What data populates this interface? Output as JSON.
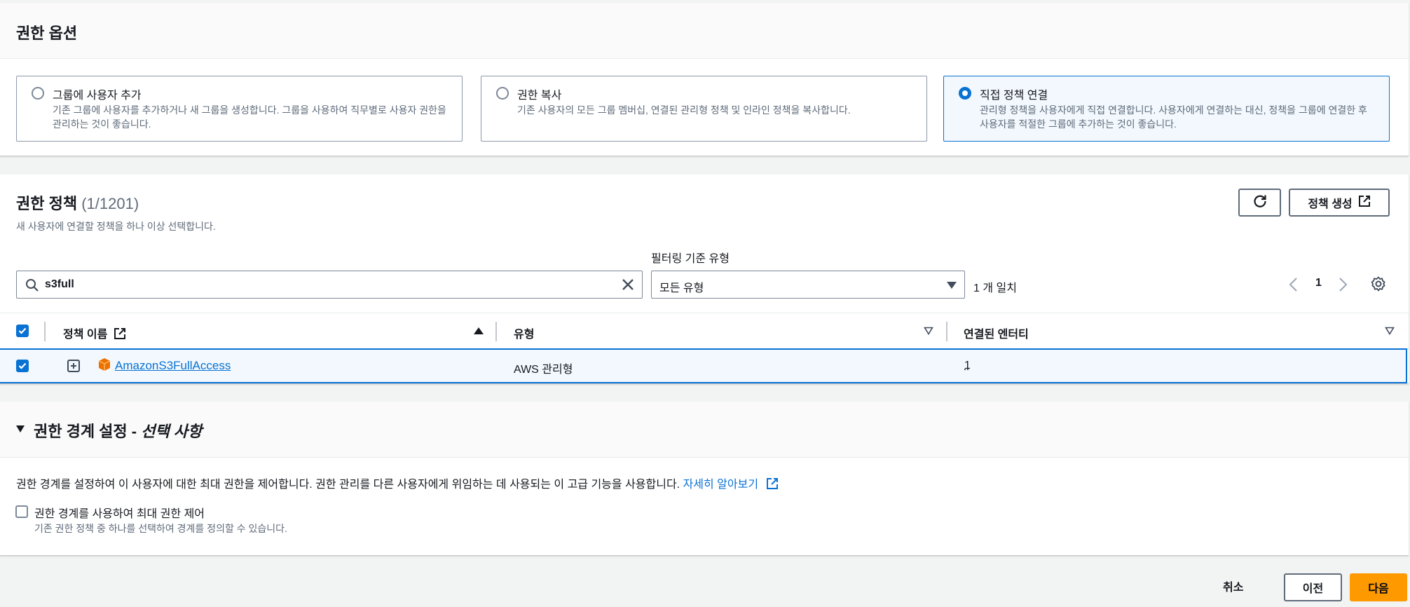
{
  "permission_options": {
    "title": "권한 옵션",
    "options": [
      {
        "label": "그룹에 사용자 추가",
        "description": "기존 그룹에 사용자를 추가하거나 새 그룹을 생성합니다. 그룹을 사용하여 직무별로 사용자 권한을 관리하는 것이 좋습니다.",
        "selected": false
      },
      {
        "label": "권한 복사",
        "description": "기존 사용자의 모든 그룹 멤버십, 연결된 관리형 정책 및 인라인 정책을 복사합니다.",
        "selected": false
      },
      {
        "label": "직접 정책 연결",
        "description": "관리형 정책을 사용자에게 직접 연결합니다. 사용자에게 연결하는 대신, 정책을 그룹에 연결한 후 사용자를 적절한 그룹에 추가하는 것이 좋습니다.",
        "selected": true
      }
    ]
  },
  "policies": {
    "title": "권한 정책",
    "count": "(1/1201)",
    "subtitle": "새 사용자에 연결할 정책을 하나 이상 선택합니다.",
    "create_button": "정책 생성",
    "filter_label": "필터링 기준 유형",
    "search_value": "s3full",
    "type_select": "모든 유형",
    "match_text": "1 개 일치",
    "page": "1",
    "columns": {
      "name": "정책 이름",
      "type": "유형",
      "entities": "연결된 엔터티"
    },
    "rows": [
      {
        "name": "AmazonS3FullAccess",
        "type": "AWS 관리형",
        "entities": "1",
        "checked": true
      }
    ]
  },
  "boundary": {
    "title": "권한 경계 설정 - ",
    "title_optional": "선택 사항",
    "description": "권한 경계를 설정하여 이 사용자에 대한 최대 권한을 제어합니다. 권한 관리를 다른 사용자에게 위임하는 데 사용되는 이 고급 기능을 사용합니다. ",
    "learn_more": "자세히 알아보기",
    "checkbox_label": "권한 경계를 사용하여 최대 권한 제어",
    "checkbox_desc": "기존 권한 정책 중 하나를 선택하여 경계를 정의할 수 있습니다."
  },
  "footer": {
    "cancel": "취소",
    "previous": "이전",
    "next": "다음"
  },
  "colors": {
    "accent": "#0972d3",
    "primary_button": "#ff9900",
    "aws_icon": "#ed7100"
  }
}
